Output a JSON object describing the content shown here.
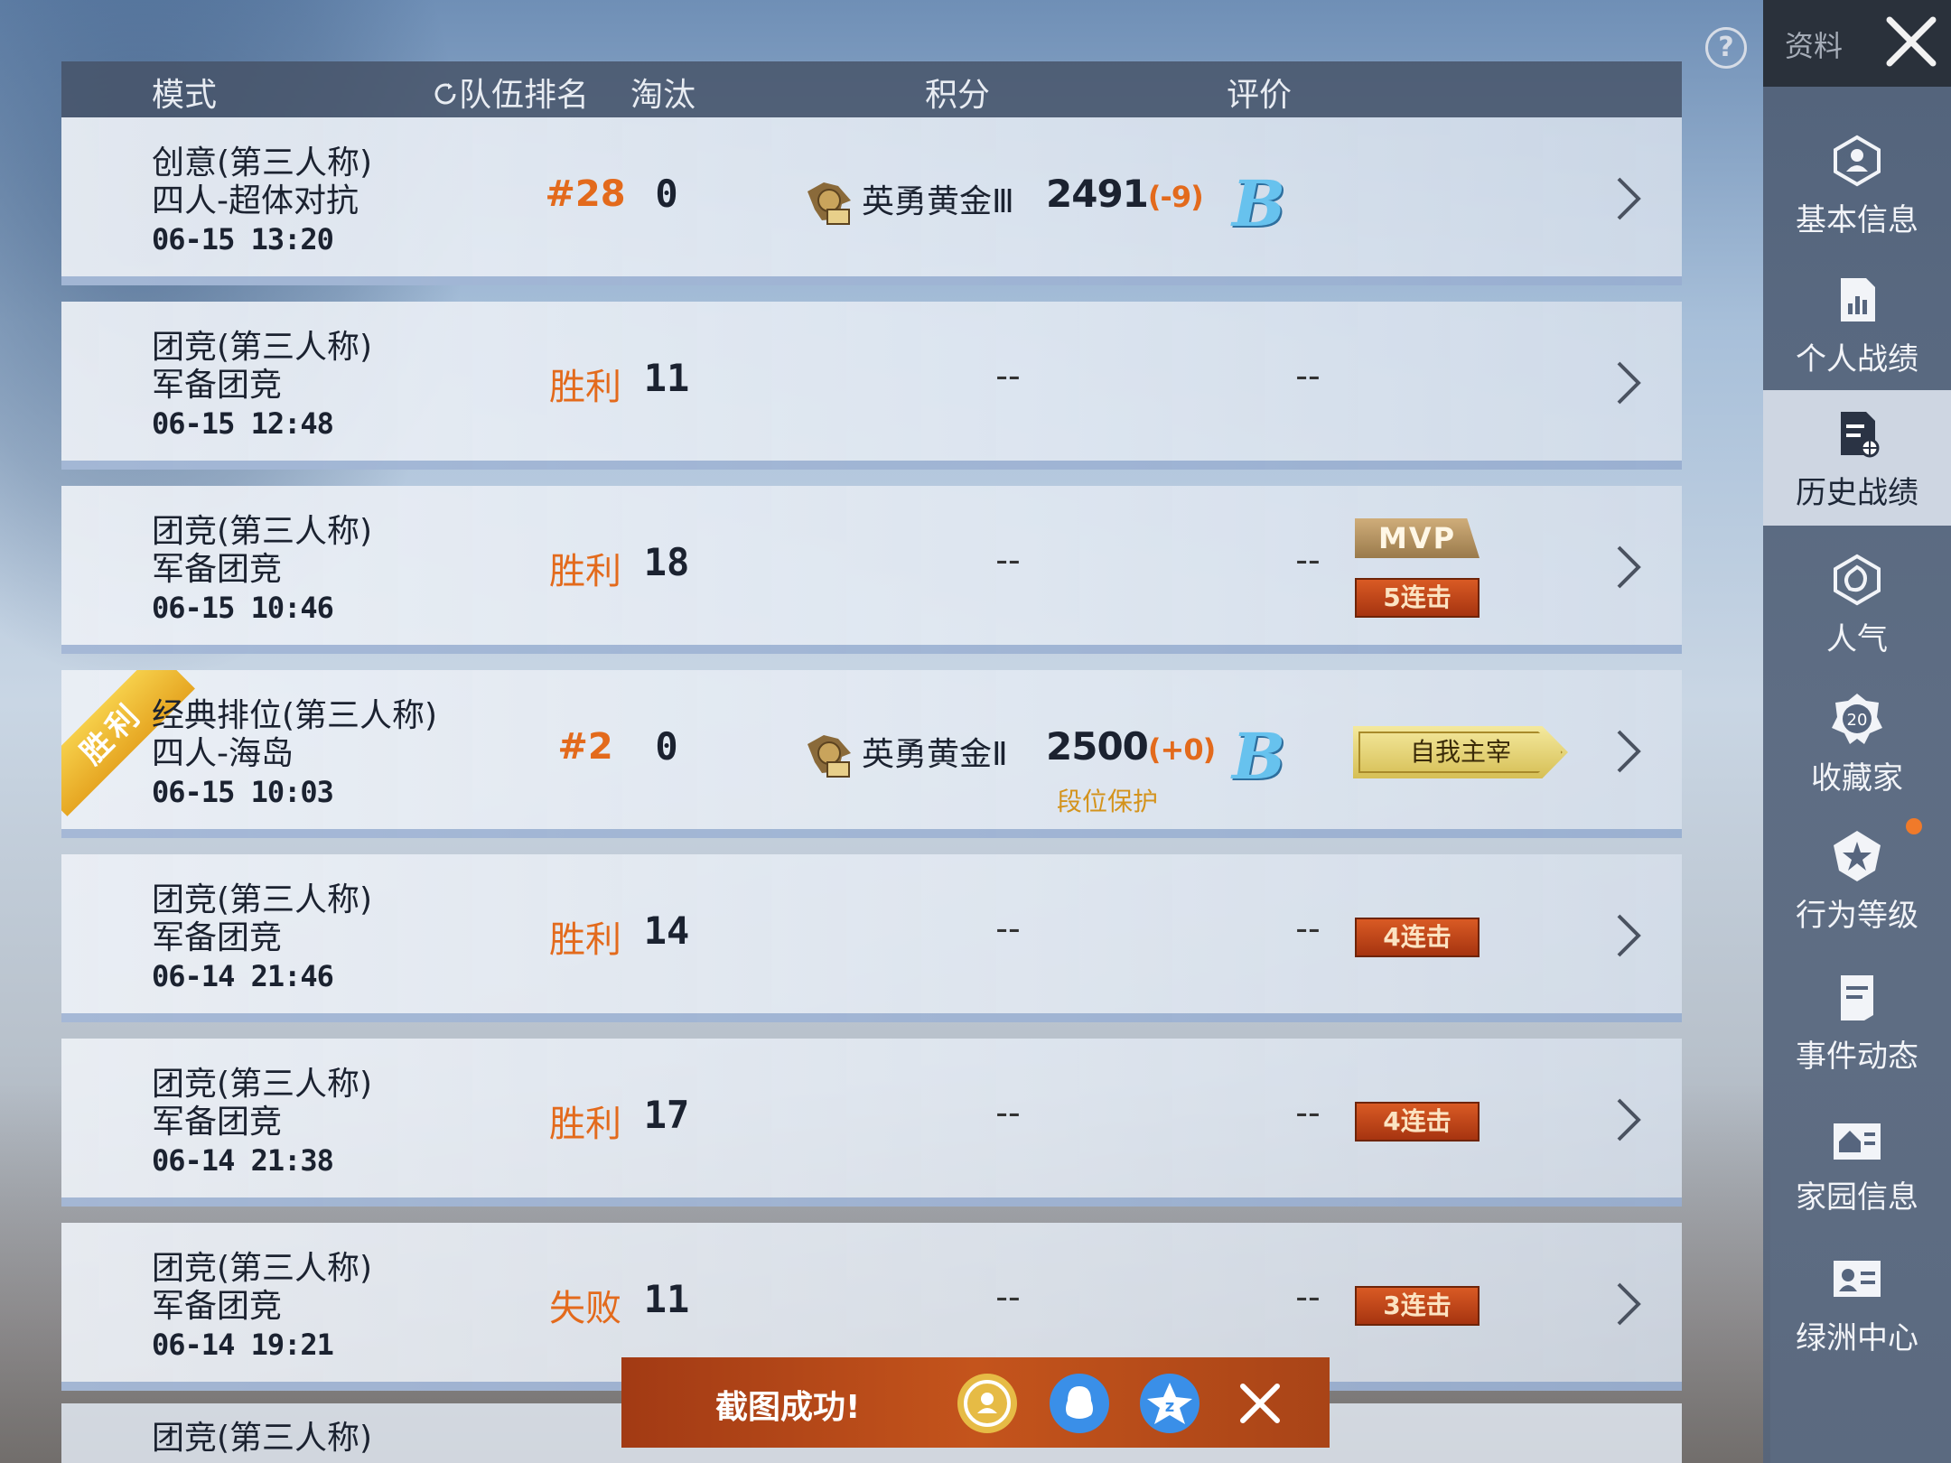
{
  "header": {
    "mode": "模式",
    "team_rank": "队伍排名",
    "kills": "淘汰",
    "score": "积分",
    "rating": "评价"
  },
  "rows": [
    {
      "mode_line1": "创意(第三人称)",
      "mode_line2": "四人-超体对抗",
      "date": "06-15 13:20",
      "rank": "#28",
      "kills": "0",
      "tier_name": "英勇黄金Ⅲ",
      "score": "2491",
      "score_delta": "(-9)",
      "grade": "B"
    },
    {
      "mode_line1": "团竞(第三人称)",
      "mode_line2": "军备团竞",
      "date": "06-15 12:48",
      "rank": "胜利",
      "kills": "11",
      "score_dash": "--",
      "grade_dash": "--"
    },
    {
      "mode_line1": "团竞(第三人称)",
      "mode_line2": "军备团竞",
      "date": "06-15 10:46",
      "rank": "胜利",
      "kills": "18",
      "score_dash": "--",
      "grade_dash": "--",
      "badge_top": "MVP",
      "badge": "5连击"
    },
    {
      "ribbon": "胜利",
      "mode_line1": "经典排位(第三人称)",
      "mode_line2": "四人-海岛",
      "date": "06-15 10:03",
      "rank": "#2",
      "kills": "0",
      "tier_name": "英勇黄金Ⅱ",
      "score": "2500",
      "score_delta": "(+0)",
      "protect": "段位保护",
      "grade": "B",
      "badge": "自我主宰"
    },
    {
      "mode_line1": "团竞(第三人称)",
      "mode_line2": "军备团竞",
      "date": "06-14 21:46",
      "rank": "胜利",
      "kills": "14",
      "score_dash": "--",
      "grade_dash": "--",
      "badge": "4连击"
    },
    {
      "mode_line1": "团竞(第三人称)",
      "mode_line2": "军备团竞",
      "date": "06-14 21:38",
      "rank": "胜利",
      "kills": "17",
      "score_dash": "--",
      "grade_dash": "--",
      "badge": "4连击"
    },
    {
      "mode_line1": "团竞(第三人称)",
      "mode_line2": "军备团竞",
      "date": "06-14 19:21",
      "rank": "失败",
      "kills": "11",
      "score_dash": "--",
      "grade_dash": "--",
      "badge": "3连击"
    }
  ],
  "partial_row": {
    "mode_line1": "团竞(第三人称)"
  },
  "sidebar": {
    "top_label": "资料",
    "items": [
      {
        "label": "基本信息",
        "icon": "profile-icon"
      },
      {
        "label": "个人战绩",
        "icon": "stats-icon"
      },
      {
        "label": "历史战绩",
        "icon": "history-icon",
        "active": true
      },
      {
        "label": "人气",
        "icon": "popularity-icon"
      },
      {
        "label": "收藏家",
        "icon": "collector-icon",
        "icon_text": "20"
      },
      {
        "label": "行为等级",
        "icon": "behavior-icon",
        "notification": true
      },
      {
        "label": "事件动态",
        "icon": "events-icon"
      },
      {
        "label": "家园信息",
        "icon": "home-icon"
      },
      {
        "label": "绿洲中心",
        "icon": "oasis-icon"
      }
    ]
  },
  "toast": {
    "text": "截图成功!"
  },
  "colors": {
    "accent_orange": "#e36a1c",
    "grade_blue": "#67c2ee",
    "badge_red": "#c4481a",
    "gold": "#d6bf55"
  }
}
